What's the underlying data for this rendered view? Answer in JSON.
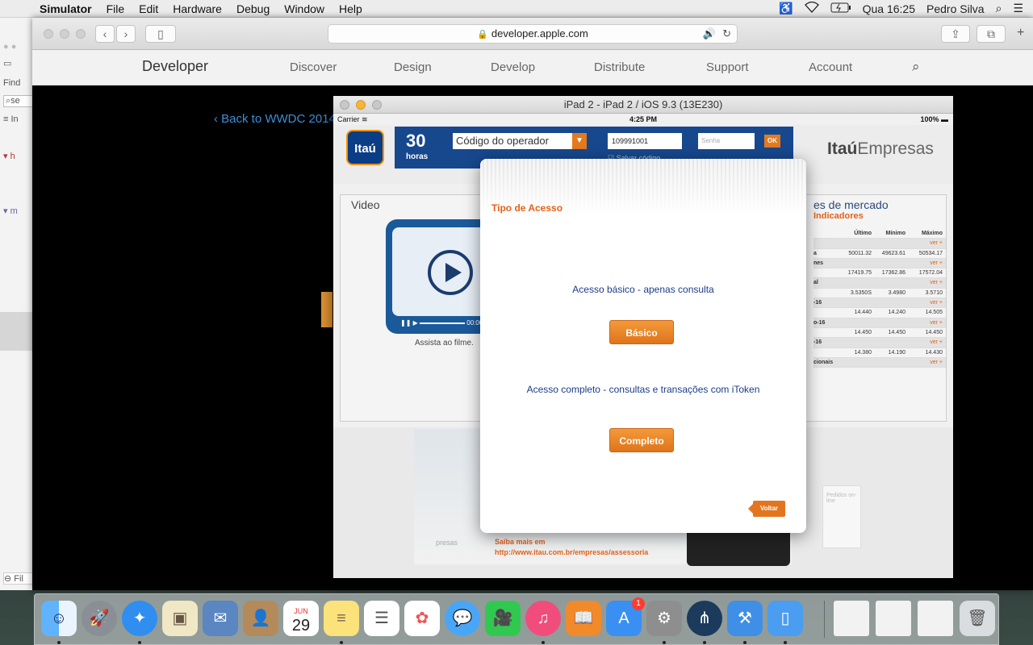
{
  "menubar": {
    "app": "Simulator",
    "items": [
      "File",
      "Edit",
      "Hardware",
      "Debug",
      "Window",
      "Help"
    ],
    "clock": "Qua 16:25",
    "user": "Pedro Silva"
  },
  "xcode": {
    "find_label": "Find",
    "search_value": "se",
    "filter_placeholder": "Fil"
  },
  "safari": {
    "url": "developer.apple.com",
    "brand": "Developer",
    "nav": [
      "Discover",
      "Design",
      "Develop",
      "Distribute",
      "Support",
      "Account"
    ],
    "back_link": "Back to WWDC 2014"
  },
  "simulator": {
    "title": "iPad 2 - iPad 2 / iOS 9.3 (13E230)",
    "status": {
      "carrier": "Carrier",
      "time": "4:25 PM",
      "battery": "100%"
    },
    "header": {
      "logo": "Itaú",
      "badge_number": "30",
      "badge_word": "horas",
      "operator_placeholder": "Código do operador",
      "operator_code": "109991001",
      "password_placeholder": "Senha",
      "ok": "OK",
      "save_code": "Salvar código",
      "brand_bold": "Itaú",
      "brand_rest": "Empresas"
    },
    "video": {
      "title": "Video",
      "time": "00:00",
      "caption": "Assista ao filme."
    },
    "market": {
      "title": "es de mercado",
      "subtitle": "Indicadores",
      "headers": [
        "Último",
        "Mínimo",
        "Máximo"
      ],
      "rows": [
        {
          "label": "",
          "values": [
            "",
            "",
            ""
          ],
          "ver": "ver +"
        },
        {
          "label": "a",
          "values": [
            "50011.32",
            "49623.61",
            "50534.17"
          ],
          "ver": ""
        },
        {
          "label": "nes",
          "values": [
            "",
            "",
            ""
          ],
          "ver": "ver +"
        },
        {
          "label": "",
          "values": [
            "17419.75",
            "17362.86",
            "17572.04"
          ],
          "ver": ""
        },
        {
          "label": "al",
          "values": [
            "",
            "",
            ""
          ],
          "ver": "ver +"
        },
        {
          "label": "",
          "values": [
            "3.5350S",
            "3.4980",
            "3.5710"
          ],
          "ver": ""
        },
        {
          "label": "-16",
          "values": [
            "",
            "",
            ""
          ],
          "ver": "ver +"
        },
        {
          "label": "",
          "values": [
            "14.440",
            "14.240",
            "14.505"
          ],
          "ver": ""
        },
        {
          "label": "o-16",
          "values": [
            "",
            "",
            ""
          ],
          "ver": "ver +"
        },
        {
          "label": "",
          "values": [
            "14.450",
            "14.450",
            "14.450"
          ],
          "ver": ""
        },
        {
          "label": "-16",
          "values": [
            "",
            "",
            ""
          ],
          "ver": "ver +"
        },
        {
          "label": "",
          "values": [
            "14.380",
            "14.190",
            "14.430"
          ],
          "ver": ""
        },
        {
          "label": "cionais",
          "values": [
            "",
            "",
            ""
          ],
          "ver": "ver +"
        }
      ]
    },
    "banner": {
      "empresas": "presas",
      "saiba": "Saiba mais em",
      "link": "http://www.itau.com.br/empresas/assessoria",
      "bag": "Pedidos on-line"
    },
    "modal": {
      "title": "Tipo de Acesso",
      "basic_text": "Acesso básico - apenas consulta",
      "basic_button": "Básico",
      "full_text": "Acesso completo - consultas e transações com iToken",
      "full_button": "Completo",
      "back_button": "Voltar"
    }
  },
  "dock": {
    "apps": [
      "Finder",
      "Launchpad",
      "Safari",
      "Preview",
      "Mail",
      "Contacts",
      "Calendar",
      "Notes",
      "Reminders",
      "Photos",
      "Messages",
      "FaceTime",
      "iTunes",
      "iBooks",
      "App Store",
      "System Preferences",
      "SourceTree",
      "Xcode",
      "Simulator"
    ],
    "calendar_month": "JUN",
    "calendar_day": "29",
    "appstore_badge": "1"
  }
}
